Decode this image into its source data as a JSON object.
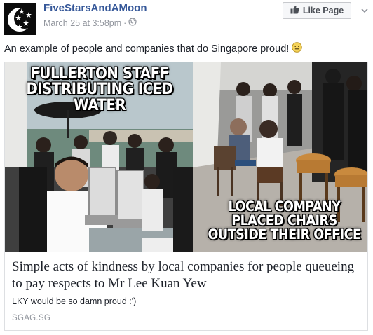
{
  "post": {
    "page_name": "FiveStarsAndAMoon",
    "timestamp": "March 25 at 3:58pm",
    "separator": "·",
    "privacy_icon": "globe-icon",
    "like_button_label": "Like Page",
    "like_icon": "thumbs-up-icon",
    "dropdown_icon": "chevron-down-icon",
    "text": "An example of people and companies that do Singapore proud!",
    "emoji": "smiley-emoji"
  },
  "avatar": {
    "logo": "five-stars-and-moon-logo",
    "colors": {
      "background": "#0b0b0b",
      "moon": "#ffffff"
    }
  },
  "link_card": {
    "image_text_left": "FULLERTON STAFF DISTRIBUTING ICED WATER",
    "image_text_right": "LOCAL COMPANY PLACED CHAIRS OUTSIDE THEIR OFFICE",
    "title": "Simple acts of kindness by local companies for people queueing to pay respects to Mr Lee Kuan Yew",
    "description": "LKY would be so damn proud :')",
    "domain": "SGAG.SG"
  },
  "colors": {
    "link_blue": "#365899",
    "meta_gray": "#90949c",
    "text": "#1d2129",
    "border": "#dddfe2"
  }
}
